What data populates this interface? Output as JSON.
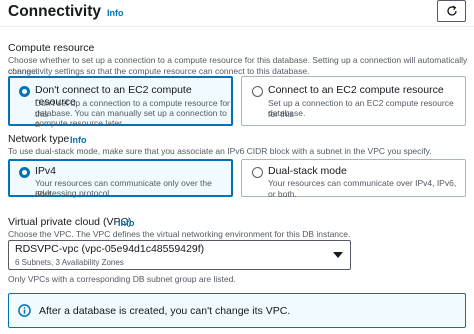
{
  "header": {
    "title": "Connectivity",
    "info": "Info",
    "refresh_icon": "refresh-icon"
  },
  "compute": {
    "label": "Compute resource",
    "description_line1": "Choose whether to set up a connection to a compute resource for this database. Setting up a connection will automatically change",
    "description_line2": "connectivity settings so that the compute resource can connect to this database.",
    "options": [
      {
        "title": "Don't connect to an EC2 compute resource",
        "desc1": "Don't set up a connection to a compute resource for this",
        "desc2": "database. You can manually set up a connection to a",
        "desc3": "compute resource later.",
        "selected": true
      },
      {
        "title": "Connect to an EC2 compute resource",
        "desc1": "Set up a connection to an EC2 compute resource for this",
        "desc2": "database.",
        "selected": false
      }
    ]
  },
  "network": {
    "label": "Network type",
    "info": "Info",
    "description": "To use dual-stack mode, make sure that you associate an IPv6 CIDR block with a subnet in the VPC you specify.",
    "options": [
      {
        "title": "IPv4",
        "desc1": "Your resources can communicate only over the IPv4",
        "desc2": "addressing protocol.",
        "selected": true
      },
      {
        "title": "Dual-stack mode",
        "desc1": "Your resources can communicate over IPv4, IPv6, or both.",
        "selected": false
      }
    ]
  },
  "vpc": {
    "label": "Virtual private cloud (VPC)",
    "info": "Info",
    "description": "Choose the VPC. The VPC defines the virtual networking environment for this DB instance.",
    "selected_value": "RDSVPC-vpc (vpc-05e94d1c48559429f)",
    "selected_sub": "6 Subnets, 3 Availability Zones",
    "note": "Only VPCs with a corresponding DB subnet group are listed."
  },
  "alert": {
    "text": "After a database is created, you can't change its VPC.",
    "icon": "info-circle-icon",
    "color": "#0073bb"
  }
}
